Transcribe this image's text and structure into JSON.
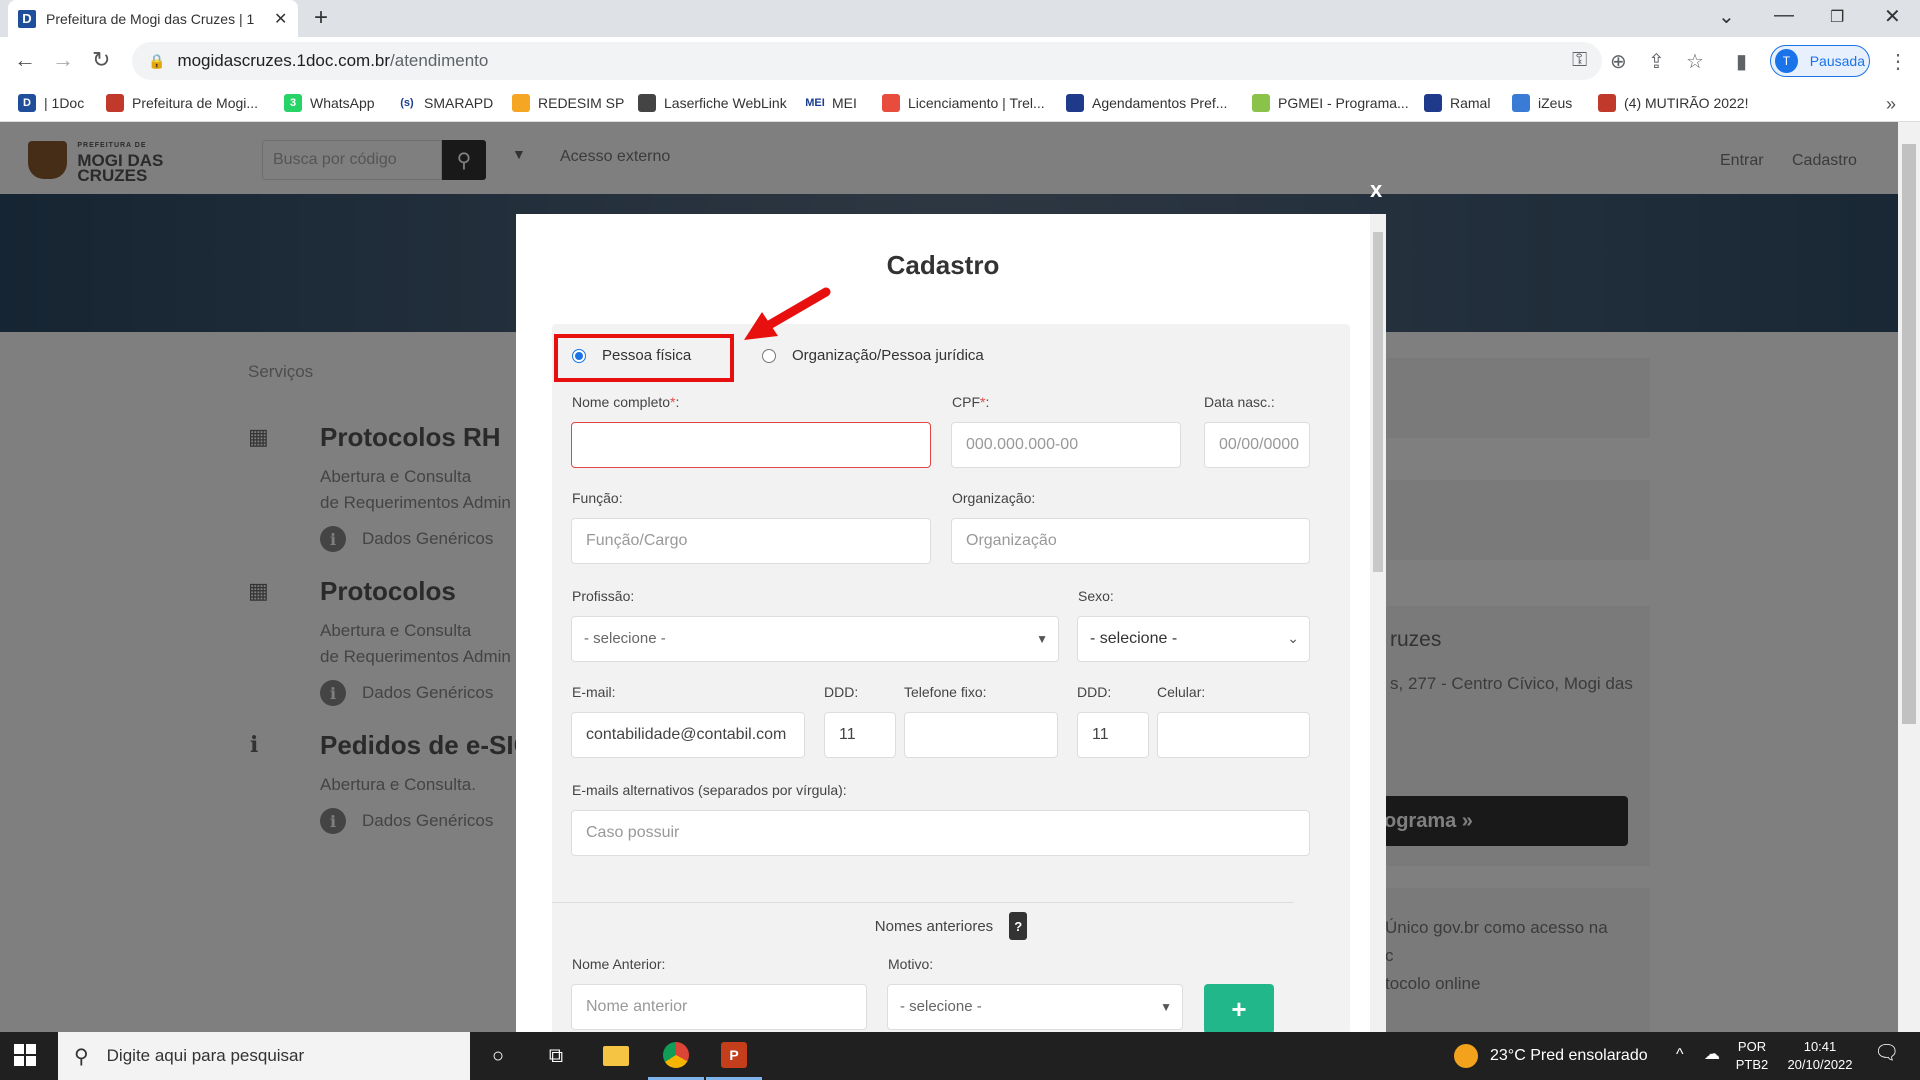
{
  "browser": {
    "tab_title": "Prefeitura de Mogi das Cruzes | 1",
    "url_host": "mogidascruzes.1doc.com.br",
    "url_path": "/atendimento",
    "profile_initial": "T",
    "profile_label": "Pausada"
  },
  "bookmarks": [
    {
      "label": "| 1Doc",
      "icon": "1doc-icon",
      "color": "#1f4e9a",
      "glyph": "D"
    },
    {
      "label": "Prefeitura de Mogi...",
      "icon": "flag-icon",
      "color": "#c0392b",
      "glyph": ""
    },
    {
      "label": "WhatsApp",
      "icon": "whatsapp-icon",
      "color": "#25d366",
      "glyph": "3"
    },
    {
      "label": "SMARAPD",
      "icon": "smarapd-icon",
      "color": "#ffffff",
      "glyph": "(s)"
    },
    {
      "label": "REDESIM SP",
      "icon": "redesim-icon",
      "color": "#f5a623",
      "glyph": ""
    },
    {
      "label": "Laserfiche WebLink",
      "icon": "laserfiche-icon",
      "color": "#444444",
      "glyph": ""
    },
    {
      "label": "MEI",
      "icon": "mei-icon",
      "color": "#ffffff",
      "glyph": "MEI"
    },
    {
      "label": "Licenciamento | Trel...",
      "icon": "licenciamento-icon",
      "color": "#e74c3c",
      "glyph": ""
    },
    {
      "label": "Agendamentos Pref...",
      "icon": "flag-icon",
      "color": "#1f3a8a",
      "glyph": ""
    },
    {
      "label": "PGMEI - Programa...",
      "icon": "pgmei-icon",
      "color": "#8bc34a",
      "glyph": ""
    },
    {
      "label": "Ramal",
      "icon": "flag-icon",
      "color": "#1f3a8a",
      "glyph": ""
    },
    {
      "label": "iZeus",
      "icon": "izeus-icon",
      "color": "#3a7bd5",
      "glyph": ""
    },
    {
      "label": "(4) MUTIRÃO 2022!",
      "icon": "mutirao-icon",
      "color": "#c0392b",
      "glyph": ""
    }
  ],
  "site": {
    "logo_small": "PREFEITURA DE",
    "logo_main": "MOGI DAS CRUZES",
    "search_placeholder": "Busca por código",
    "external_access": "Acesso externo",
    "login": "Entrar",
    "register": "Cadastro",
    "services_label": "Serviços",
    "services": [
      {
        "title": "Protocolos RH",
        "desc1": "Abertura e Consulta",
        "desc2": "de Requerimentos Admin",
        "info": "Dados Genéricos",
        "icon": "grid-icon"
      },
      {
        "title": "Protocolos",
        "desc1": "Abertura e Consulta",
        "desc2": "de Requerimentos Admin",
        "info": "Dados Genéricos",
        "icon": "grid-icon"
      },
      {
        "title": "Pedidos de e-SIC",
        "desc1": "Abertura e Consulta.",
        "desc2": "",
        "info": "Dados Genéricos",
        "icon": "info-icon"
      }
    ],
    "right_city": "ruzes",
    "right_address": "s, 277 - Centro Cívico, Mogi das",
    "right_button": "ograma »",
    "right_gov1": "Único gov.br como acesso na",
    "right_gov2": "c",
    "right_gov3": "tocolo online"
  },
  "modal": {
    "close": "x",
    "title": "Cadastro",
    "radio_pf": "Pessoa física",
    "radio_pj": "Organização/Pessoa jurídica",
    "nome_label": "Nome completo",
    "required_mark": "*",
    "colon": ":",
    "cpf_label": "CPF",
    "cpf_placeholder": "000.000.000-00",
    "nasc_label": "Data nasc.:",
    "nasc_placeholder": "00/00/0000",
    "funcao_label": "Função:",
    "funcao_placeholder": "Função/Cargo",
    "org_label": "Organização:",
    "org_placeholder": "Organização",
    "profissao_label": "Profissão:",
    "profissao_value": "- selecione -",
    "sexo_label": "Sexo:",
    "sexo_value": "- selecione -",
    "email_label": "E-mail:",
    "email_value": "contabilidade@contabil.com",
    "ddd_label": "DDD:",
    "ddd_fixo_value": "11",
    "fixo_label": "Telefone fixo:",
    "ddd_cel_value": "11",
    "cel_label": "Celular:",
    "alt_label": "E-mails alternativos (separados por vírgula):",
    "alt_placeholder": "Caso possuir",
    "nomes_anteriores": "Nomes anteriores",
    "help": "?",
    "nome_ant_label": "Nome Anterior:",
    "nome_ant_placeholder": "Nome anterior",
    "motivo_label": "Motivo:",
    "motivo_value": "- selecione -",
    "add": "+"
  },
  "taskbar": {
    "search_placeholder": "Digite aqui para pesquisar",
    "weather": "23°C  Pred ensolarado",
    "lang1": "POR",
    "lang2": "PTB2",
    "time": "10:41",
    "date": "20/10/2022"
  },
  "colors": {
    "accent": "#1a73e8",
    "annotation": "#e8100f",
    "add_button": "#21b78b"
  }
}
